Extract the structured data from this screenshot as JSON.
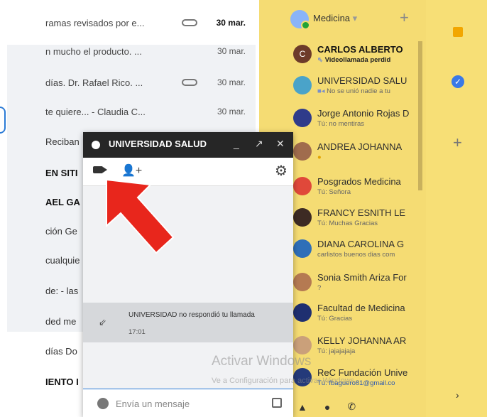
{
  "colors": {
    "hangouts_bg": "#f5dc73",
    "chat_header": "#262626",
    "accent": "#2b7bd6",
    "arrow": "#e8261c"
  },
  "mail": [
    {
      "snippet": "ramas revisados por e...",
      "date": "30 mar.",
      "bold": true
    },
    {
      "snippet": "n mucho el producto. ...",
      "date": "30 mar."
    },
    {
      "snippet": "días. Dr. Rafael Rico. ...",
      "date": "30 mar."
    },
    {
      "snippet": "te quiere... - Claudia C...",
      "date": "30 mar."
    }
  ],
  "mail_trunc": [
    "Reciban",
    "EN SITI",
    "AEL GA",
    "ción Ge",
    "cualquie",
    "de: - las",
    "ded me",
    "días Do",
    "IENTO I"
  ],
  "hangouts": {
    "me": {
      "name": "Medicina",
      "add": "+"
    },
    "contacts": [
      {
        "name": "CARLOS ALBERTO",
        "status": "Videollamada perdid",
        "avatar_color": "#6d3b2a",
        "initial": "C",
        "bold": true
      },
      {
        "name": "UNIVERSIDAD SALU",
        "status": "No se unió nadie a tu",
        "avatar_color": "#4aa3c9"
      },
      {
        "name": "Jorge Antonio Rojas D",
        "status": "Tú: no mentiras",
        "avatar_color": "#2f3b8a"
      },
      {
        "name": "ANDREA JOHANNA",
        "status": "",
        "avatar_color": "#a06c4d"
      },
      {
        "name": "Posgrados Medicina",
        "status": "Tú: Señora",
        "avatar_color": "#e0483a"
      },
      {
        "name": "FRANCY ESNITH LE",
        "status": "Tú: Muchas Gracias",
        "avatar_color": "#3d2b24"
      },
      {
        "name": "DIANA CAROLINA G",
        "status": "carlistos buenos dias com",
        "avatar_color": "#2f6fb8"
      },
      {
        "name": "Sonia Smith Ariza For",
        "status": "?",
        "avatar_color": "#b57a52"
      },
      {
        "name": "Facultad de Medicina",
        "status": "Tú: Gracias",
        "avatar_color": "#1f2f70"
      },
      {
        "name": "KELLY JOHANNA AR",
        "status": "Tú: jajajajaja",
        "avatar_color": "#caa07a"
      },
      {
        "name": "ReC Fundación Unive",
        "status": "Tú: fbaguero81@gmail.co",
        "avatar_color": "#243a7a"
      }
    ],
    "bottom": [
      "person-icon",
      "chat-icon",
      "phone-icon"
    ]
  },
  "chat": {
    "title": "UNIVERSIDAD SALUD",
    "controls": [
      "_",
      "↗",
      "✕"
    ],
    "system_message": "UNIVERSIDAD no respondió tu llamada",
    "time": "17:01",
    "placeholder": "Envía un mensaje"
  },
  "watermark": {
    "line1": "Activar Windows",
    "line2": "Ve a Configuración para activar Windows."
  }
}
